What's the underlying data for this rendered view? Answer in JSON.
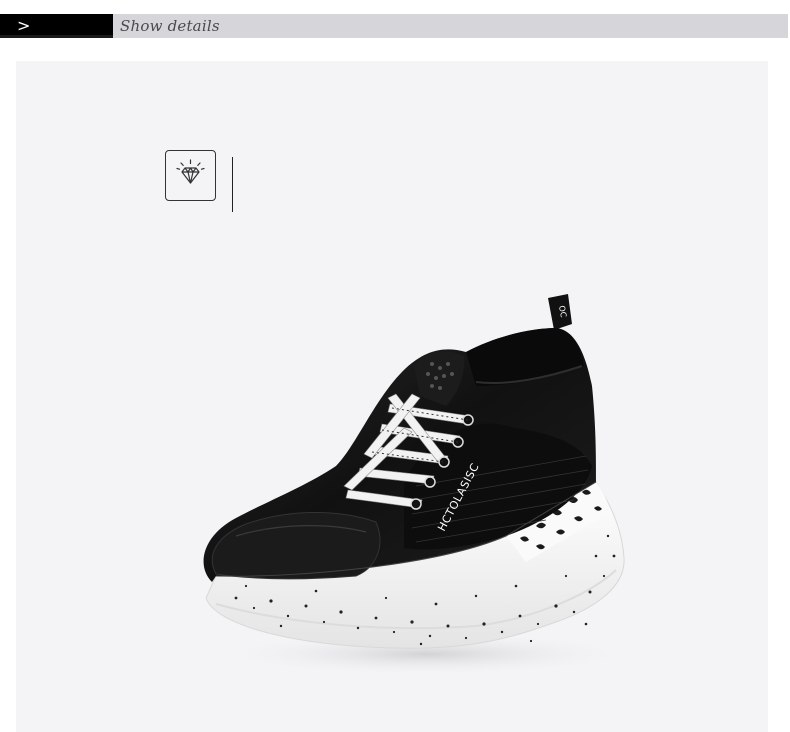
{
  "header": {
    "chevron": ">",
    "title": "Show details"
  },
  "shoe": {
    "brand_text": "HCTOLASISC",
    "tab_text": "OC",
    "icon": "diamond-icon"
  },
  "colors": {
    "header_black": "#000000",
    "header_gray": "#d6d6da",
    "stage_bg": "#f4f4f6",
    "shoe_black": "#141414",
    "sole_white": "#f5f5f5"
  }
}
